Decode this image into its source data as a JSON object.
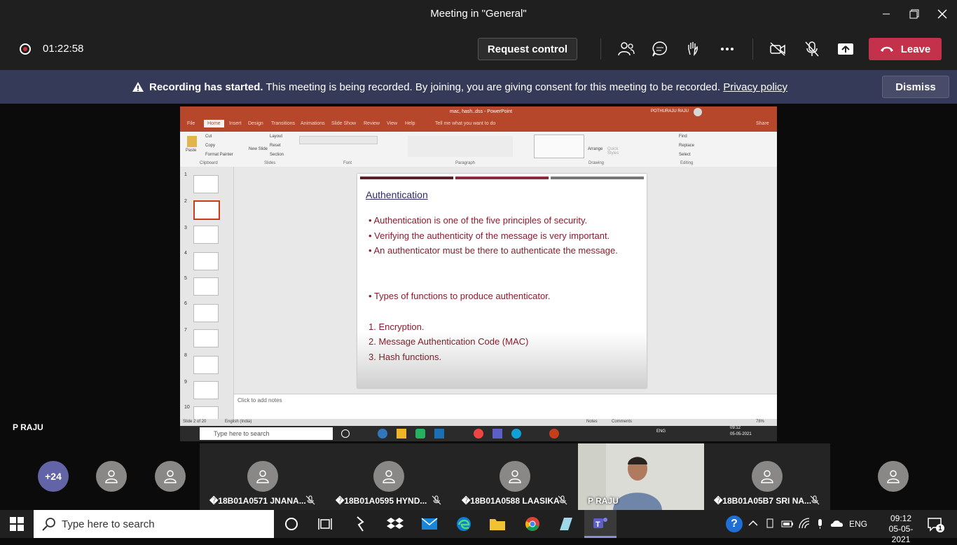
{
  "window": {
    "title": "Meeting in \"General\""
  },
  "meeting": {
    "timer": "01:22:58",
    "request_control_label": "Request control",
    "leave_label": "Leave"
  },
  "banner": {
    "bold_text": "Recording has started.",
    "text": "This meeting is being recorded. By joining, you are giving consent for this meeting to be recorded.",
    "link": "Privacy policy",
    "dismiss_label": "Dismiss"
  },
  "shared_screen": {
    "presenter": "P RAJU",
    "ppt_title": "mac, hash..dss - PowerPoint",
    "ppt_user": "POTHURAJU RAJU",
    "tabs": [
      "File",
      "Home",
      "Insert",
      "Design",
      "Transitions",
      "Animations",
      "Slide Show",
      "Review",
      "View",
      "Help",
      "Tell me what you want to do",
      "Share"
    ],
    "ribbon_groups": [
      "Clipboard",
      "Slides",
      "Font",
      "Paragraph",
      "Drawing",
      "Editing"
    ],
    "ribbon_items": {
      "paste": "Paste",
      "cut": "Cut",
      "copy": "Copy",
      "format_painter": "Format Painter",
      "new_slide": "New Slide",
      "layout": "Layout",
      "reset": "Reset",
      "section": "Section",
      "arrange": "Arrange",
      "quick_styles": "Quick Styles",
      "find": "Find",
      "replace": "Replace",
      "select": "Select"
    },
    "slide_numbers": [
      "1",
      "2",
      "3",
      "4",
      "5",
      "6",
      "7",
      "8",
      "9",
      "10"
    ],
    "selected_slide": 2,
    "slide": {
      "title": "Authentication",
      "bullets": [
        "Authentication is one of the five principles of security.",
        "Verifying the authenticity of the message is very important.",
        "An authenticator must be there to authenticate the message."
      ],
      "bullet2": "Types of functions to produce authenticator.",
      "numbered": [
        "1.   Encryption.",
        "2.   Message Authentication Code (MAC)",
        "3.   Hash functions."
      ]
    },
    "notes_placeholder": "Click to add notes",
    "status_left": "Slide 2 of 20",
    "status_lang": "English (India)",
    "status_notes": "Notes",
    "status_comments": "Comments",
    "status_zoom": "78%",
    "inner_taskbar": {
      "search_placeholder": "Type here to search",
      "time": "09:12",
      "date": "05-05-2021",
      "lang": "ENG"
    }
  },
  "participants": {
    "more_count": "+24",
    "tiles": [
      {
        "name": "�18B01A0571 JNANA...",
        "muted": true
      },
      {
        "name": "�18B01A0595 HYND...",
        "muted": true
      },
      {
        "name": "�18B01A0588 LAASIKA",
        "muted": true
      },
      {
        "name": "P RAJU",
        "muted": false,
        "video": true
      },
      {
        "name": "�18B01A05B7 SRI NA...",
        "muted": true
      }
    ]
  },
  "taskbar": {
    "search_placeholder": "Type here to search",
    "lang": "ENG",
    "time": "09:12",
    "date": "05-05-2021",
    "notification_count": "1"
  },
  "colors": {
    "leave": "#c4314b",
    "banner": "#363a59",
    "ppt_accent": "#b7472a",
    "teams": "#6264a7"
  }
}
